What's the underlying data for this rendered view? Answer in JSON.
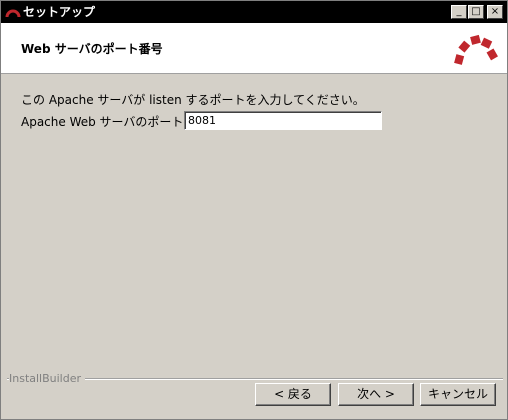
{
  "window": {
    "title": "セットアップ",
    "controls": {
      "minimize": "_",
      "maximize": "□",
      "close": "×"
    }
  },
  "header": {
    "heading": "Web サーバのポート番号",
    "logo_icon": "bitnami-arc-logo-icon",
    "logo_color": "#c0272d"
  },
  "body": {
    "description": "この Apache サーバが listen するポートを入力してください。",
    "port_label": "Apache Web サーバのポート番号",
    "port_value": "8081"
  },
  "footer": {
    "brand": "InstallBuilder",
    "back_label": "< 戻る",
    "next_label": "次へ >",
    "cancel_label": "キャンセル"
  }
}
